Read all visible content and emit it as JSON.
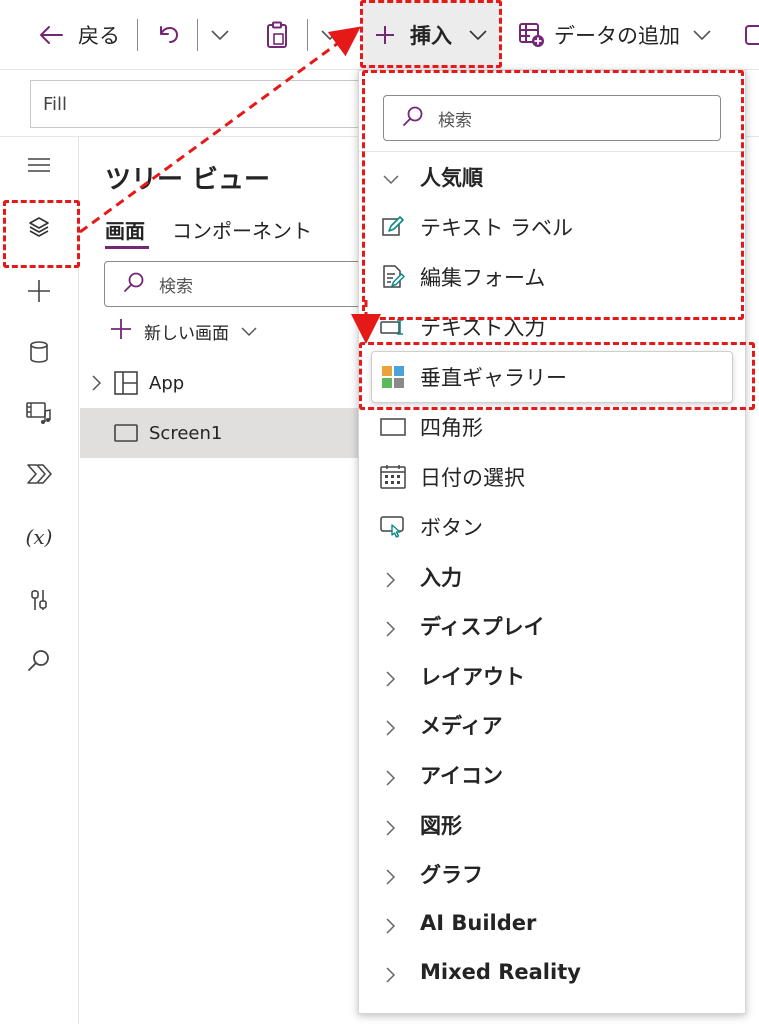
{
  "toolbar": {
    "back_label": "戻る",
    "insert_label": "挿入",
    "add_data_label": "データの追加"
  },
  "formula_bar": {
    "property": "Fill"
  },
  "tree_view": {
    "title": "ツリー ビュー",
    "tabs": [
      "画面",
      "コンポーネント"
    ],
    "search_placeholder": "検索",
    "new_screen_label": "新しい画面",
    "items": [
      {
        "label": "App",
        "icon": "app-icon"
      },
      {
        "label": "Screen1",
        "icon": "screen-icon",
        "selected": true
      }
    ]
  },
  "insert_menu": {
    "search_placeholder": "検索",
    "popular_label": "人気順",
    "popular_items": [
      {
        "label": "テキスト ラベル",
        "icon": "text-label-icon"
      },
      {
        "label": "編集フォーム",
        "icon": "edit-form-icon"
      },
      {
        "label": "テキスト入力",
        "icon": "text-input-icon"
      },
      {
        "label": "垂直ギャラリー",
        "icon": "vertical-gallery-icon",
        "highlighted": true
      },
      {
        "label": "四角形",
        "icon": "rectangle-icon"
      },
      {
        "label": "日付の選択",
        "icon": "date-picker-icon"
      },
      {
        "label": "ボタン",
        "icon": "button-icon"
      }
    ],
    "categories": [
      "入力",
      "ディスプレイ",
      "レイアウト",
      "メディア",
      "アイコン",
      "図形",
      "グラフ",
      "AI Builder",
      "Mixed Reality"
    ]
  },
  "colors": {
    "accent": "#742774",
    "annotation_red": "#e61919",
    "selected_row": "#e1dfdd"
  }
}
